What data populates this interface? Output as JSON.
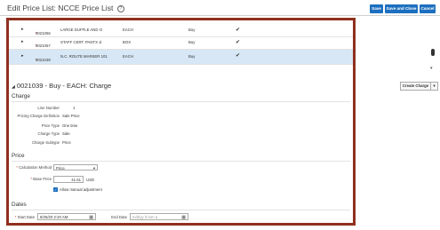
{
  "page": {
    "title": "Edit Price List: NCCE Price List"
  },
  "toolbar": {
    "save": "Save",
    "save_close": "Save and Close",
    "cancel": "Cancel"
  },
  "rows": [
    {
      "item": "0021056",
      "desc": "LARGE DUFFLE AND O",
      "uom": "EACH",
      "line_type": "Buy",
      "flag": "✔"
    },
    {
      "item": "0021057",
      "desc": "STAFF CERT. PANTX xl",
      "uom": "BOX",
      "line_type": "Buy",
      "flag": "✔"
    },
    {
      "item": "0021039",
      "desc": "N.C. ROUTE MARKER 101",
      "uom": "EACH",
      "line_type": "Buy",
      "flag": "✔"
    }
  ],
  "detail": {
    "header": "0021039 - Buy - EACH: Charge",
    "create_charge": "Create Charge",
    "charge": {
      "section": "Charge",
      "line_number_label": "Line Number",
      "line_number": "1",
      "pricing_def_label": "Pricing Charge Definition",
      "pricing_def": "Sale Price",
      "price_type_label": "Price Type",
      "price_type": "One time",
      "charge_type_label": "Charge Type",
      "charge_type": "Sale",
      "charge_subtype_label": "Charge Subtype",
      "charge_subtype": "Price"
    },
    "price": {
      "section": "Price",
      "calc_method_label": "Calculation Method",
      "calc_method": "Price",
      "base_price_label": "Base Price",
      "base_price": "41.51",
      "currency": "USD",
      "allow_manual_label": "Allow manual adjustment"
    },
    "dates": {
      "section": "Dates",
      "start_label": "Start Date",
      "start_value": "8/25/20 2:20 AM",
      "end_label": "End Date",
      "end_placeholder": "m/d/yy h:mm a"
    }
  }
}
